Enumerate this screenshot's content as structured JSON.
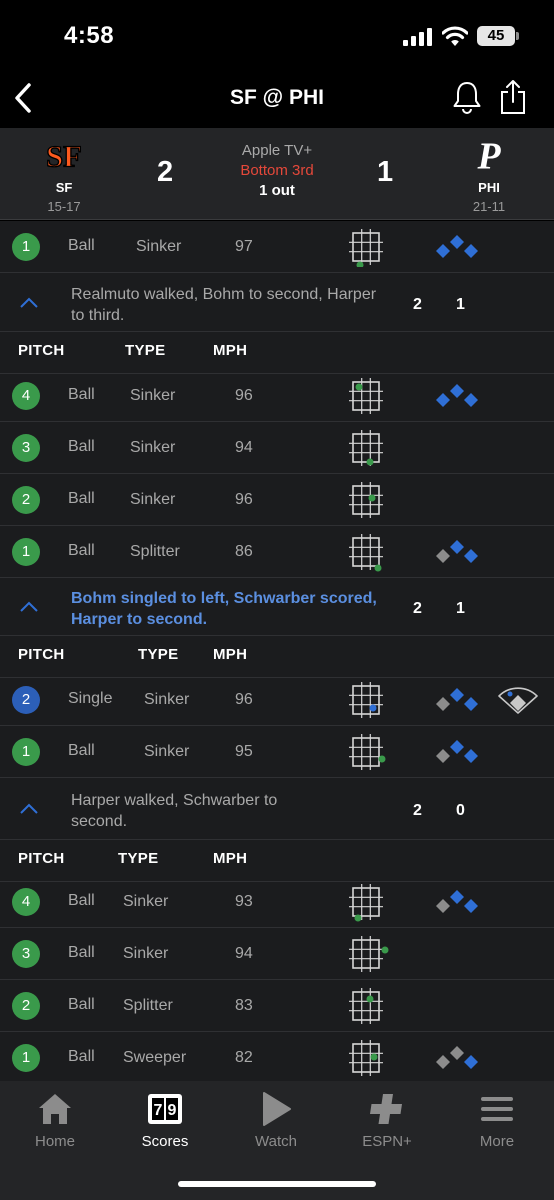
{
  "status": {
    "time": "4:58",
    "battery": "45"
  },
  "nav": {
    "title": "SF @ PHI"
  },
  "game": {
    "away": {
      "abbr": "SF",
      "record": "15-17",
      "score": "2",
      "color": "#fd5a1e"
    },
    "home": {
      "abbr": "PHI",
      "record": "21-11",
      "score": "1",
      "color": "#ffffff"
    },
    "network": "Apple TV+",
    "inning": "Bottom 3rd",
    "outs": "1 out"
  },
  "colors": {
    "ball_badge": "#3a9a4b",
    "in_play_badge": "#2c5fb8",
    "highlight_text": "#5b8fe0",
    "inning_red": "#e5483a",
    "runner_blue": "#2f6fd6"
  },
  "plays": [
    {
      "top_pitch": {
        "num": "1",
        "result": "Ball",
        "type": "Sinker",
        "mph": "97"
      }
    },
    {
      "text": "Realmuto walked, Bohm to second, Harper to third.",
      "highlight": false,
      "away_runs": "2",
      "home_runs": "1",
      "headers": {
        "pitch": "PITCH",
        "type": "TYPE",
        "mph": "MPH"
      },
      "pitches": [
        {
          "num": "4",
          "result": "Ball",
          "type": "Sinker",
          "mph": "96"
        },
        {
          "num": "3",
          "result": "Ball",
          "type": "Sinker",
          "mph": "94"
        },
        {
          "num": "2",
          "result": "Ball",
          "type": "Sinker",
          "mph": "96"
        },
        {
          "num": "1",
          "result": "Ball",
          "type": "Splitter",
          "mph": "86"
        }
      ]
    },
    {
      "text": "Bohm singled to left, Schwarber scored, Harper to second.",
      "highlight": true,
      "away_runs": "2",
      "home_runs": "1",
      "headers": {
        "pitch": "PITCH",
        "type": "TYPE",
        "mph": "MPH"
      },
      "pitches": [
        {
          "num": "2",
          "result": "Single",
          "type": "Sinker",
          "mph": "96"
        },
        {
          "num": "1",
          "result": "Ball",
          "type": "Sinker",
          "mph": "95"
        }
      ]
    },
    {
      "text": "Harper walked, Schwarber to second.",
      "highlight": false,
      "away_runs": "2",
      "home_runs": "0",
      "headers": {
        "pitch": "PITCH",
        "type": "TYPE",
        "mph": "MPH"
      },
      "pitches": [
        {
          "num": "4",
          "result": "Ball",
          "type": "Sinker",
          "mph": "93"
        },
        {
          "num": "3",
          "result": "Ball",
          "type": "Sinker",
          "mph": "94"
        },
        {
          "num": "2",
          "result": "Ball",
          "type": "Splitter",
          "mph": "83"
        },
        {
          "num": "1",
          "result": "Ball",
          "type": "Sweeper",
          "mph": "82"
        }
      ]
    }
  ],
  "tabs": [
    {
      "label": "Home",
      "icon": "home-icon"
    },
    {
      "label": "Scores",
      "icon": "scores-icon",
      "scores_digits": "79",
      "active": true
    },
    {
      "label": "Watch",
      "icon": "play-icon"
    },
    {
      "label": "ESPN+",
      "icon": "espn-plus-icon"
    },
    {
      "label": "More",
      "icon": "menu-icon"
    }
  ]
}
